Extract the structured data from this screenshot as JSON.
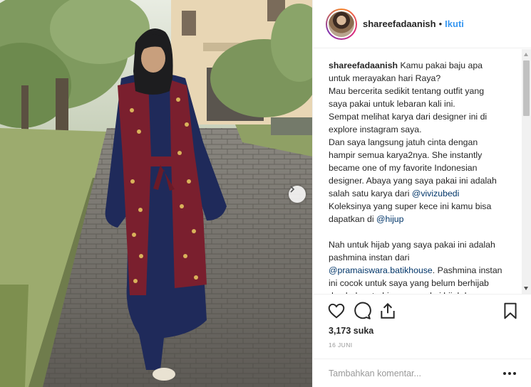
{
  "header": {
    "username": "shareefadaanish",
    "separator": "•",
    "follow_label": "Ikuti"
  },
  "caption": {
    "username": "shareefadaanish",
    "lines_a": "Kamu pakai baju apa\nuntuk merayakan hari Raya?\nMau bercerita sedikit tentang outfit yang\nsaya pakai untuk lebaran kali ini.\nSempat melihat karya dari designer ini di\nexplore instagram saya.\nDan saya langsung jatuh cinta dengan\nhampir semua karya2nya. She instantly\nbecame one of my favorite Indonesian\ndesigner. Abaya yang saya pakai ini adalah\nsalah satu karya dari ",
    "mention_1": "@vivizubedi",
    "lines_b": "\nKoleksinya yang super kece ini kamu bisa\ndapatkan di ",
    "mention_2": "@hijup",
    "lines_c": "\n\nNah untuk hijab yang saya pakai ini adalah\npashmina instan dari\n",
    "mention_3": "@pramaiswara.batikhouse",
    "lines_d": ". Pashmina instan\nini cocok untuk saya yang belum berhijab\ndan belum terbiasa memakai hijab karena\nmodelnya sangat praktis untuk digunakan."
  },
  "actions": {
    "like_icon": "heart-icon",
    "comment_icon": "speech-bubble-icon",
    "share_icon": "share-icon",
    "save_icon": "bookmark-icon"
  },
  "likes_text": "3,173 suka",
  "date_text": "16 JUNI",
  "comment": {
    "placeholder": "Tambahkan komentar...",
    "more_icon": "more-horizontal-icon"
  },
  "colors": {
    "follow": "#3897f0",
    "mention": "#003569",
    "border": "#efefef"
  }
}
